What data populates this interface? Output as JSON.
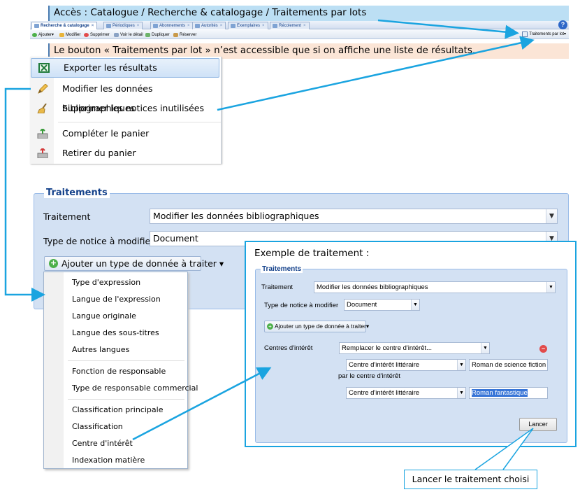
{
  "notes": {
    "top": "Accès : Catalogue / Recherche & catalogage / Traitements par lots",
    "middle": "Le bouton « Traitements par lot » n’est accessible que si on affiche une liste de résultats."
  },
  "app": {
    "tabs": [
      "Recherche & catalogage",
      "Périodiques",
      "Abonnements",
      "Autorités",
      "Exemplaires",
      "Récolement"
    ],
    "actions": [
      "Ajouter",
      "Modifier",
      "Supprimer",
      "Voir le détail",
      "Dupliquer",
      "Réserver"
    ],
    "batch_button": "Traitements par lot",
    "help_icon": "?"
  },
  "batch_menu": {
    "items": [
      "Exporter les résultats",
      "Modifier les données bibliographiques",
      "Supprimer les notices inutilisées",
      "Compléter le panier",
      "Retirer du panier"
    ]
  },
  "panel": {
    "legend": "Traitements",
    "treatment_label": "Traitement",
    "treatment_value": "Modifier les données bibliographiques",
    "notice_type_label": "Type de notice à modifier",
    "notice_type_value": "Document",
    "add_type_button": "Ajouter un type de donnée à traiter"
  },
  "type_list": {
    "group1": [
      "Type d'expression",
      "Langue de l'expression",
      "Langue originale",
      "Langue des sous-titres",
      "Autres langues"
    ],
    "group2": [
      "Fonction de responsable",
      "Type de responsable commercial"
    ],
    "group3": [
      "Classification principale",
      "Classification",
      "Centre d'intérêt",
      "Indexation matière"
    ]
  },
  "example": {
    "title": "Exemple de traitement :",
    "legend": "Traitements",
    "treatment_label": "Traitement",
    "treatment_value": "Modifier les données bibliographiques",
    "notice_type_label": "Type de notice à modifier",
    "notice_type_value": "Document",
    "add_button": "Ajouter un type de donnée à traiter",
    "interest_label": "Centres d'intérêt",
    "interest_action": "Remplacer le centre d'intérêt...",
    "interest_type_1": "Centre d'intérêt littéraire",
    "interest_value_1": "Roman de science fiction",
    "replace_label": "par le centre d'intérêt",
    "interest_type_2": "Centre d'intérêt littéraire",
    "interest_value_2": "Roman fantastique",
    "launch_button": "Lancer"
  },
  "callout": "Lancer le traitement choisi",
  "colors": {
    "accent_arrow": "#1aa4e0",
    "panel_bg": "#d3e1f3",
    "panel_title": "#15428b"
  }
}
